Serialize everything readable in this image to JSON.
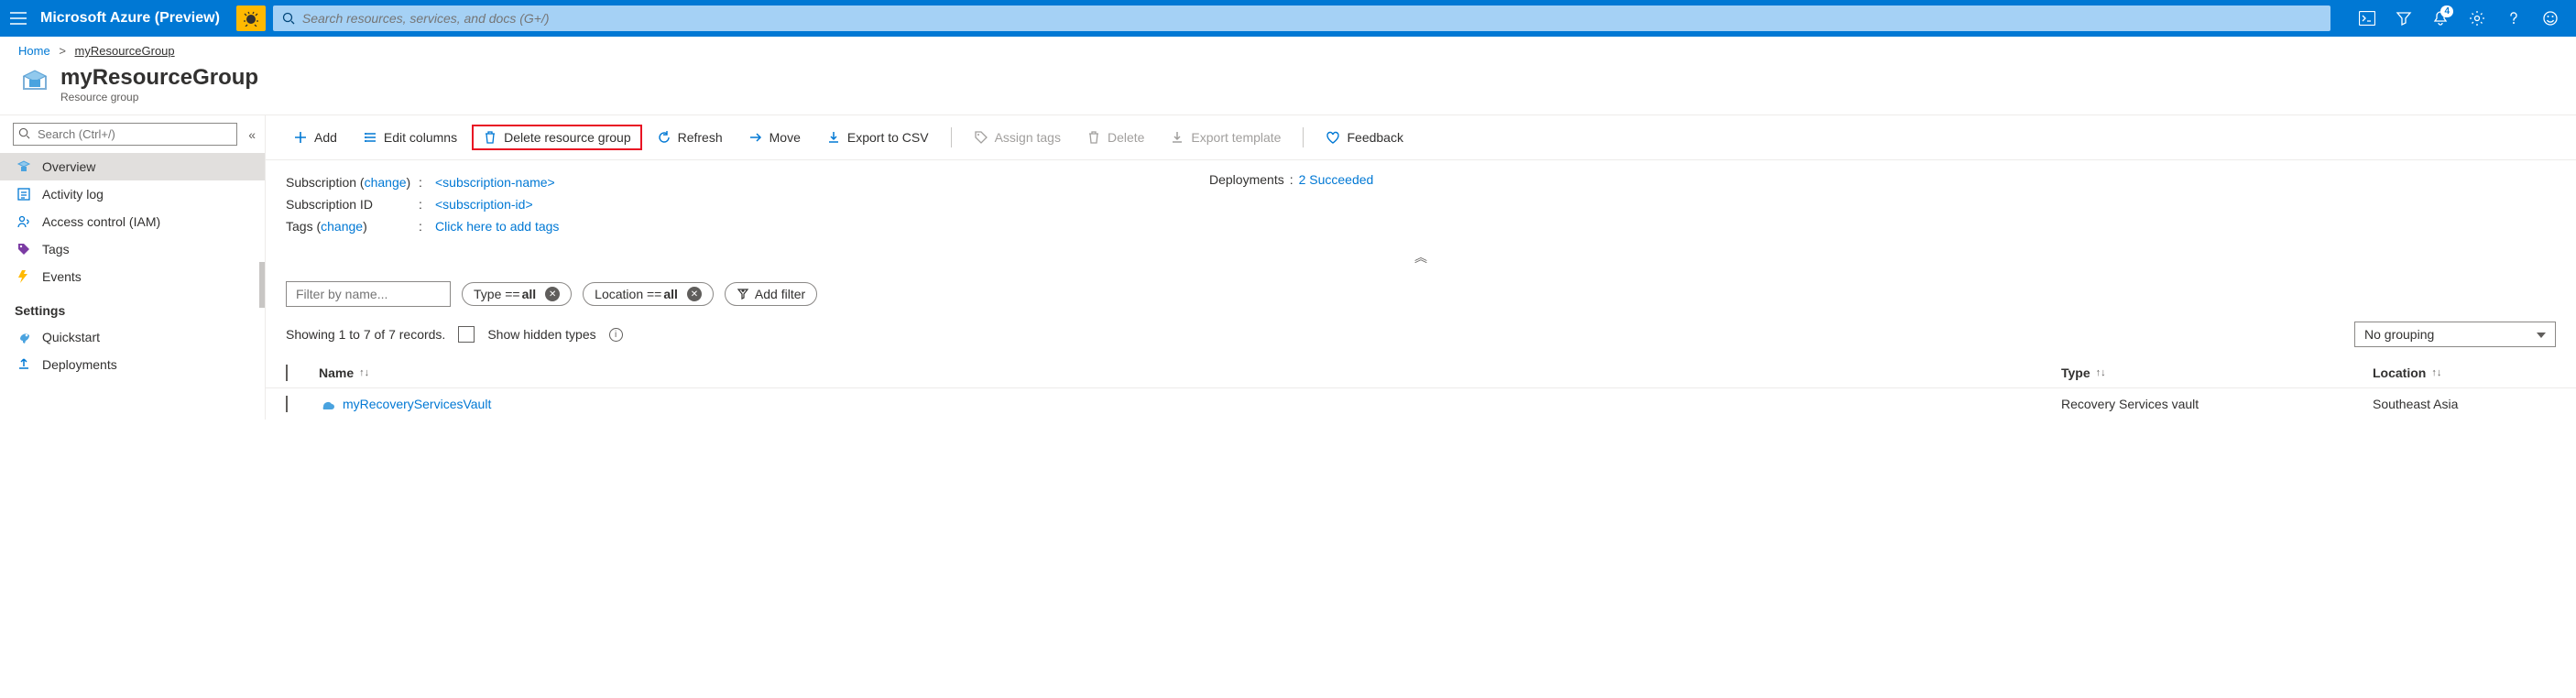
{
  "header": {
    "brand": "Microsoft Azure (Preview)",
    "search_placeholder": "Search resources, services, and docs (G+/)",
    "notification_count": "4"
  },
  "breadcrumb": {
    "home": "Home",
    "current": "myResourceGroup"
  },
  "page": {
    "title": "myResourceGroup",
    "subtitle": "Resource group"
  },
  "sidebar": {
    "search_placeholder": "Search (Ctrl+/)",
    "items": [
      {
        "label": "Overview"
      },
      {
        "label": "Activity log"
      },
      {
        "label": "Access control (IAM)"
      },
      {
        "label": "Tags"
      },
      {
        "label": "Events"
      }
    ],
    "settings_heading": "Settings",
    "settings_items": [
      {
        "label": "Quickstart"
      },
      {
        "label": "Deployments"
      }
    ]
  },
  "toolbar": {
    "add": "Add",
    "edit_columns": "Edit columns",
    "delete_rg": "Delete resource group",
    "refresh": "Refresh",
    "move": "Move",
    "export_csv": "Export to CSV",
    "assign_tags": "Assign tags",
    "delete": "Delete",
    "export_template": "Export template",
    "feedback": "Feedback"
  },
  "info": {
    "subscription_label": "Subscription",
    "change": "change",
    "subscription_value": "<subscription-name>",
    "subscription_id_label": "Subscription ID",
    "subscription_id_value": "<subscription-id>",
    "tags_label": "Tags",
    "tags_value": "Click here to add tags",
    "deployments_label": "Deployments",
    "deployments_value": "2 Succeeded"
  },
  "filters": {
    "filter_placeholder": "Filter by name...",
    "type_prefix": "Type == ",
    "type_value": "all",
    "location_prefix": "Location == ",
    "location_value": "all",
    "add_filter": "Add filter"
  },
  "records": {
    "showing": "Showing 1 to 7 of 7 records.",
    "show_hidden": "Show hidden types",
    "grouping": "No grouping"
  },
  "table": {
    "columns": {
      "name": "Name",
      "type": "Type",
      "location": "Location"
    },
    "rows": [
      {
        "name": "myRecoveryServicesVault",
        "type": "Recovery Services vault",
        "location": "Southeast Asia"
      }
    ]
  }
}
